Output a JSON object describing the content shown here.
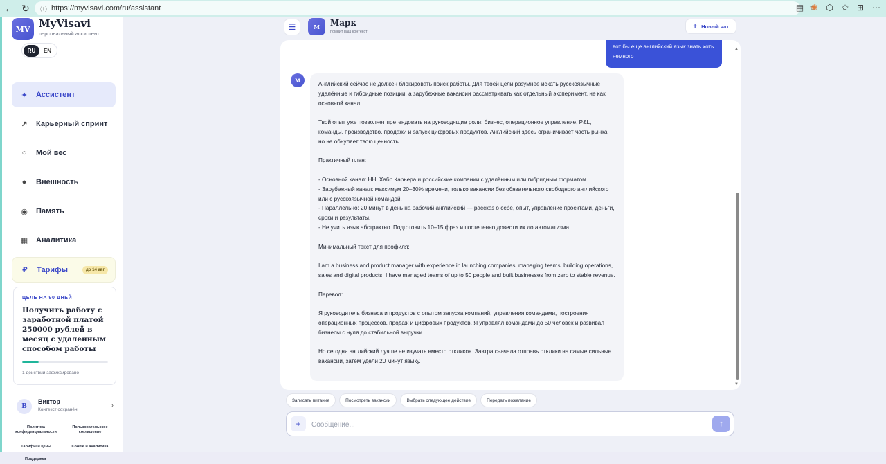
{
  "browser": {
    "url": "https://myvisavi.com/ru/assistant"
  },
  "sidebar": {
    "logo_text": "MV",
    "brand": "MyVisavi",
    "brand_sub": "персональный ассистент",
    "lang_ru": "RU",
    "lang_en": "EN",
    "items": [
      {
        "label": "Ассистент",
        "icon": "sparkle-icon",
        "glyph": "✦"
      },
      {
        "label": "Карьерный спринт",
        "icon": "arrow-up-right-icon",
        "glyph": "↗"
      },
      {
        "label": "Мой вес",
        "icon": "circle-icon",
        "glyph": "○"
      },
      {
        "label": "Внешность",
        "icon": "dot-icon",
        "glyph": "●"
      },
      {
        "label": "Память",
        "icon": "memory-icon",
        "glyph": "◉"
      },
      {
        "label": "Аналитика",
        "icon": "grid-icon",
        "glyph": "▦"
      }
    ],
    "tarif": {
      "label": "Тарифы",
      "glyph": "₽",
      "badge": "до 14 авг"
    },
    "goal": {
      "tag": "ЦЕЛЬ НА 90 ДНЕЙ",
      "title": "Получить работу с заработной платой 250000 рублей в месяц с удаленным способом работы",
      "progress_fraction": 0.19,
      "note": "1 действий зафиксировано"
    },
    "user": {
      "initial": "В",
      "name": "Виктор",
      "sub": "Контекст сохранён"
    },
    "footer_links": [
      "Политика конфиденциальности",
      "Пользовательское соглашение",
      "Тарифы и цены",
      "Cookie и аналитика"
    ],
    "support": "Поддержка"
  },
  "chat": {
    "agent_initial": "М",
    "agent_name": "Марк",
    "agent_sub": "помнит ваш контекст",
    "new_chat": "Новый чат",
    "user_message": "вот бы еще английский язык знать хоть немного",
    "bot_message_lines": [
      "Английский сейчас не должен блокировать поиск работы. Для твоей цели разумнее искать русскоязычные удалённые и гибридные позиции, а зарубежные вакансии рассматривать как отдельный эксперимент, не как основной канал.",
      "",
      "Твой опыт уже позволяет претендовать на руководящие роли: бизнес, операционное управление, P&L, команды, производство, продажи и запуск цифровых продуктов. Английский здесь ограничивает часть рынка, но не обнуляет твою ценность.",
      "",
      "Практичный план:",
      "",
      "- Основной канал: HH, Хабр Карьера и российские компании с удалённым или гибридным форматом.",
      "- Зарубежный канал: максимум 20–30% времени, только вакансии без обязательного свободного английского или с русскоязычной командой.",
      "- Параллельно: 20 минут в день на рабочий английский — рассказ о себе, опыт, управление проектами, деньги, сроки и результаты.",
      "- Не учить язык абстрактно. Подготовить 10–15 фраз и постепенно довести их до автоматизма.",
      "",
      "Минимальный текст для профиля:",
      "",
      "I am a business and product manager with experience in launching companies, managing teams, building operations, sales and digital products. I have managed teams of up to 50 people and built businesses from zero to stable revenue.",
      "",
      "Перевод:",
      "",
      "Я руководитель бизнеса и продуктов с опытом запуска компаний, управления командами, построения операционных процессов, продаж и цифровых продуктов. Я управлял командами до 50 человек и развивал бизнесы с нуля до стабильной выручки.",
      "",
      "Но сегодня английский лучше не изучать вместо откликов. Завтра сначала отправь отклики на самые сильные вакансии, затем удели 20 минут языку."
    ],
    "quick_actions": [
      "Записать питание",
      "Посмотреть вакансии",
      "Выбрать следующее действие",
      "Передать пожелание"
    ],
    "input_placeholder": "Сообщение..."
  },
  "colors": {
    "accent": "#3a47c8",
    "user_bubble": "#3a52d8",
    "progress": "#1fb59a"
  }
}
